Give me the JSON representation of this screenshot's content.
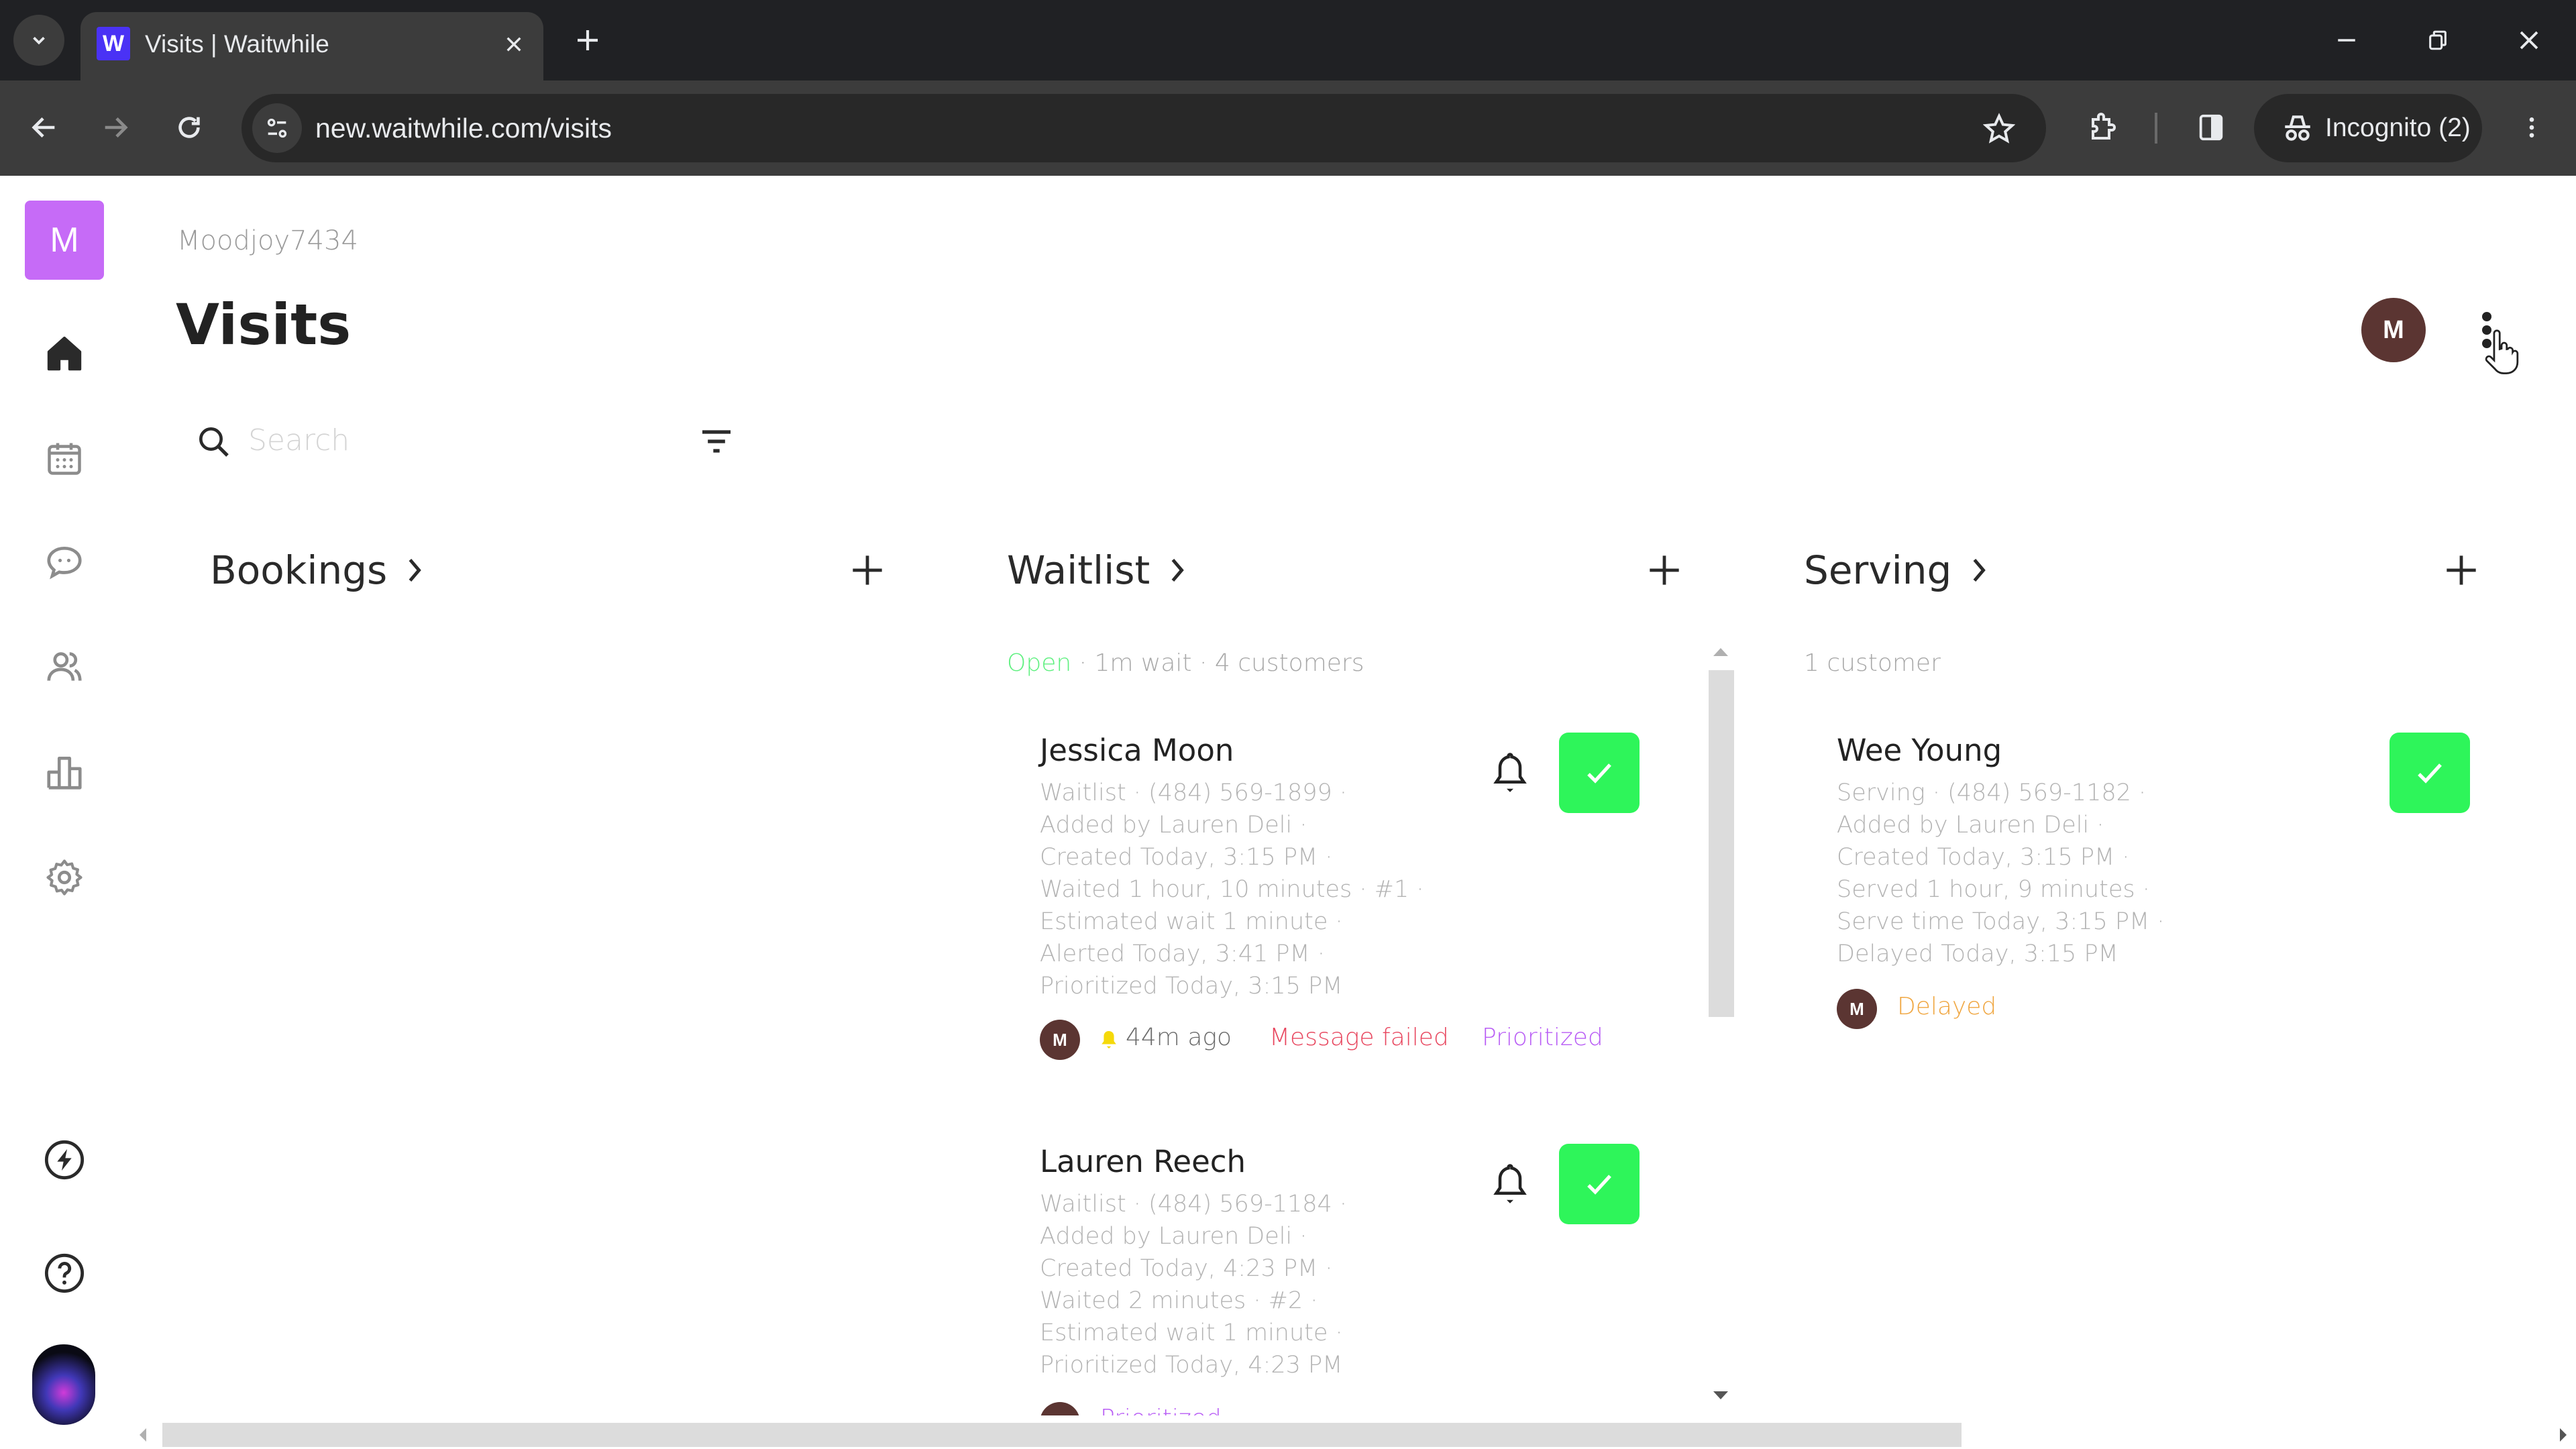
{
  "browser": {
    "tab_title": "Visits | Waitwhile",
    "favicon_letter": "W",
    "url": "new.waitwhile.com/visits",
    "incognito_label": "Incognito (2)",
    "new_tab_symbol": "+",
    "close_tab_symbol": "✕"
  },
  "sidebar": {
    "brand_letter": "M",
    "items": [
      {
        "name": "home",
        "icon": "home-icon",
        "active": true
      },
      {
        "name": "calendar",
        "icon": "calendar-icon"
      },
      {
        "name": "messages",
        "icon": "chat-icon"
      },
      {
        "name": "customers",
        "icon": "people-icon"
      },
      {
        "name": "analytics",
        "icon": "bar-chart-icon"
      },
      {
        "name": "settings",
        "icon": "gear-icon"
      }
    ],
    "bottom_items": [
      {
        "name": "whats-new",
        "icon": "lightning-icon"
      },
      {
        "name": "help",
        "icon": "help-icon"
      },
      {
        "name": "profile",
        "icon": "user-photo"
      }
    ]
  },
  "header": {
    "org_name": "Moodjoy7434",
    "title": "Visits",
    "account_initial": "M"
  },
  "search": {
    "placeholder": "Search",
    "value": ""
  },
  "columns": {
    "bookings": {
      "title": "Bookings",
      "chevron": "›",
      "add": "+"
    },
    "waitlist": {
      "title": "Waitlist",
      "chevron": "›",
      "add": "+",
      "status": "Open",
      "summary": " · 1m wait · 4 customers",
      "cards": [
        {
          "name": "Jessica Moon",
          "lines": [
            "Waitlist · (484) 569-1899 ·",
            "Added by Lauren Deli ·",
            "Created Today, 3:15 PM ·",
            "Waited 1 hour, 10 minutes · #1 ·",
            "Estimated wait 1 minute ·",
            "Alerted Today, 3:41 PM ·",
            "Prioritized Today, 3:15 PM"
          ],
          "avatar_initial": "M",
          "alert_time": "44m ago",
          "message_status": "Message failed",
          "tag": "Prioritized"
        },
        {
          "name": "Lauren Reech",
          "lines": [
            "Waitlist · (484) 569-1184 ·",
            "Added by Lauren Deli ·",
            "Created Today, 4:23 PM ·",
            "Waited 2 minutes · #2 ·",
            "Estimated wait 1 minute ·",
            "Prioritized Today, 4:23 PM"
          ],
          "avatar_initial": "M",
          "tag": "Prioritized"
        }
      ]
    },
    "serving": {
      "title": "Serving",
      "chevron": "›",
      "add": "+",
      "summary": "1 customer",
      "cards": [
        {
          "name": "Wee Young",
          "lines": [
            "Serving · (484) 569-1182 ·",
            "Added by Lauren Deli ·",
            "Created Today, 3:15 PM ·",
            "Served 1 hour, 9 minutes ·",
            "Serve time Today, 3:15 PM ·",
            "Delayed Today, 3:15 PM"
          ],
          "avatar_initial": "M",
          "tag": "Delayed"
        }
      ]
    }
  },
  "colors": {
    "brand": "#c66bf7",
    "success": "#2ef55a",
    "open_status": "#5ef07f",
    "error": "#e8475f",
    "prioritized": "#b85cf5",
    "delayed": "#f0a640",
    "avatar": "#5b3532",
    "alert_bell": "#f5d90a"
  }
}
